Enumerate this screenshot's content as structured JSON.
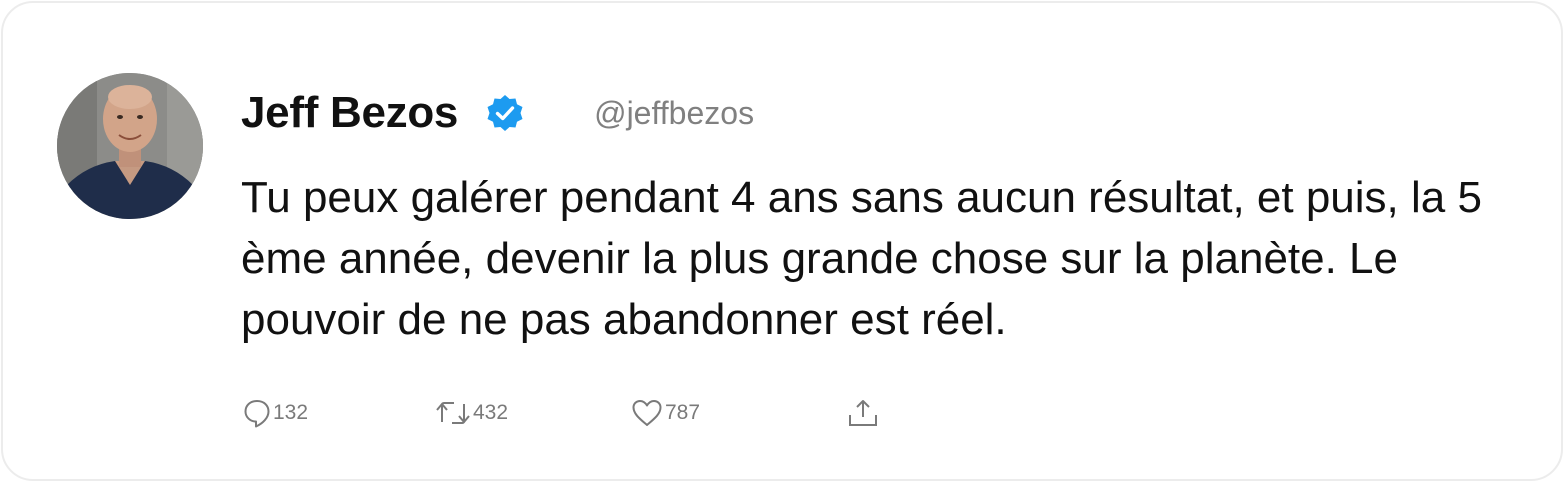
{
  "tweet": {
    "author": {
      "name": "Jeff Bezos",
      "handle": "@jeffbezos",
      "verified": true,
      "avatar_icon": "profile-photo"
    },
    "text": "Tu peux galérer pendant 4 ans sans aucun résultat, et puis, la 5 ème année, devenir la plus grande chose sur la planète. Le pouvoir de ne pas abandonner est réel.",
    "actions": {
      "replies": "132",
      "retweets": "432",
      "likes": "787",
      "icons": {
        "reply": "speech-bubble-icon",
        "retweet": "retweet-icon",
        "like": "heart-icon",
        "share": "share-icon"
      }
    }
  },
  "colors": {
    "verified_badge": "#1d9bf0",
    "muted_text": "#808080",
    "main_text": "#111111"
  }
}
